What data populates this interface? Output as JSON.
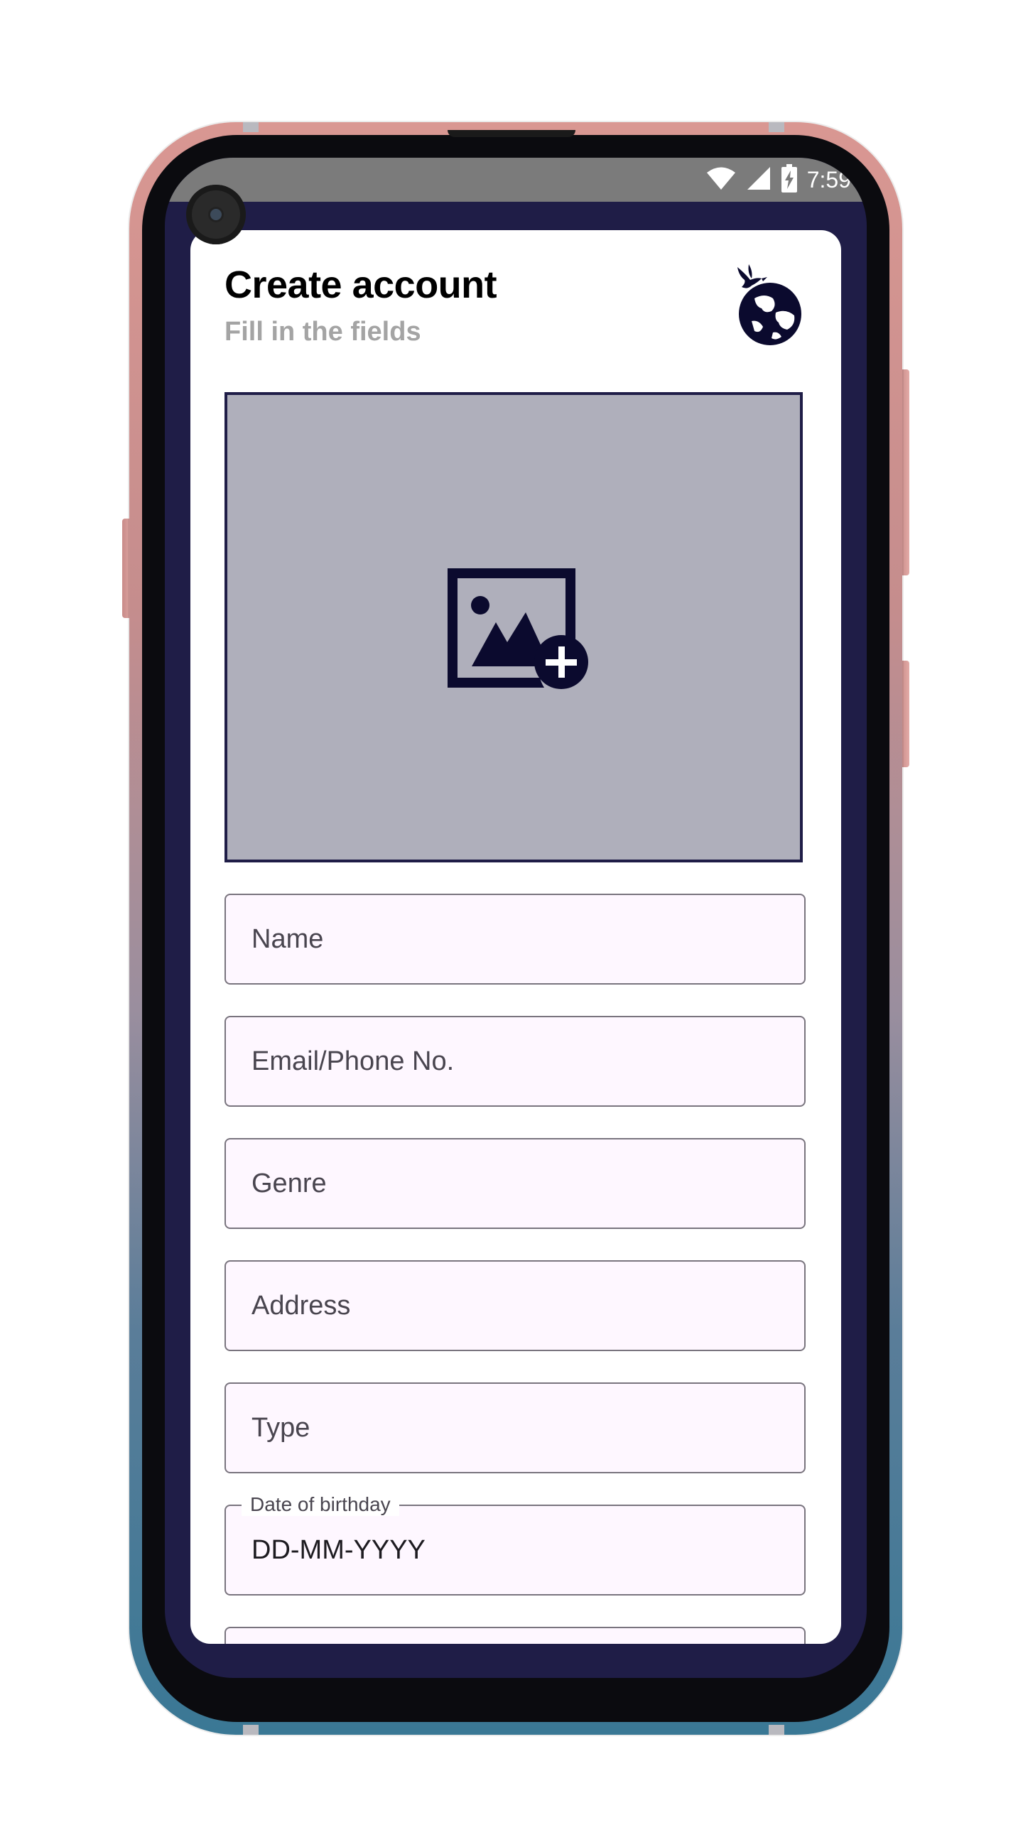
{
  "status_bar": {
    "time": "7:59",
    "icons": [
      "wifi-icon",
      "cellular-signal-icon",
      "battery-charging-icon"
    ]
  },
  "header": {
    "title": "Create account",
    "subtitle": "Fill in the fields",
    "logo": "globe-with-dove-logo"
  },
  "photo_picker": {
    "icon": "add-photo-icon"
  },
  "form": {
    "name_placeholder": "Name",
    "email_placeholder": "Email/Phone No.",
    "genre_placeholder": "Genre",
    "address_placeholder": "Address",
    "type_placeholder": "Type",
    "birthday_label": "Date of birthday",
    "birthday_value": "DD-MM-YYYY"
  },
  "colors": {
    "screen_background": "#1f1d47",
    "status_bar": "#7b7b7b",
    "photo_box_fill": "#afafbb",
    "photo_box_border": "#1f1d47",
    "icon_dark": "#0b0a2e",
    "subtitle": "#a4a4a4",
    "field_background": "#fef7ff",
    "field_border": "#79747e"
  }
}
